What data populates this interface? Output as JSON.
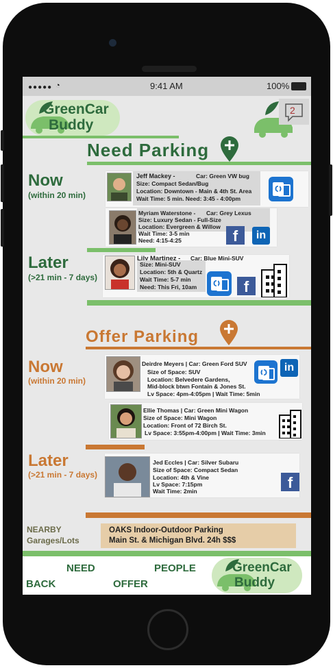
{
  "status": {
    "time": "9:41 AM",
    "battery": "100%"
  },
  "header": {
    "logo_line1": "GreenCar",
    "logo_line2": "Buddy",
    "notifications": "2"
  },
  "need": {
    "title": "Need Parking",
    "now_label": "Now",
    "now_sub": "(within 20 min)",
    "later_label": "Later",
    "later_sub": "(>21 min - 7 days)",
    "cards": [
      {
        "name": "Jeff Mackey -",
        "car": "Car: Green VW bug",
        "line2": "Size: Compact Sedan/Bug",
        "line3": "Location: Downtown - Main & 4th St. Area",
        "line4": "Wait Time: 5 min.       Need: 3:45 - 4:00pm"
      },
      {
        "name": "Myriam Waterstone -",
        "car": "Car: Grey Lexus",
        "line2": "Size:  Luxury Sedan - Full-Size",
        "line3": "Location:  Evergreen & Willow",
        "line4": "Wait Time:  3-5 min",
        "line5": "Need: 4:15-4:25"
      },
      {
        "name": "Lily Martinez -",
        "car": "Car:  Blue Mini-SUV",
        "line2": "Size:  Mini-SUV",
        "line3": "Location: 5th & Quartz",
        "line4": "Wait Time: 5-7 min",
        "line5": "Need: This Fri, 10am"
      }
    ]
  },
  "offer": {
    "title": "Offer Parking",
    "now_label": "Now",
    "now_sub": "(within 20 min)",
    "later_label": "Later",
    "later_sub": "(>21 min - 7 days)",
    "cards": [
      {
        "line1": "Deirdre Meyers  | Car: Green Ford SUV",
        "line2": "Size of Space: SUV",
        "line3": "Location: Belvedere Gardens,",
        "line4": "Mid-block btwn Fontain & Jones St.",
        "line5": "Lv Space:  4pm-4:05pm |   Wait Time: 5min"
      },
      {
        "line1": "Ellie Thomas | Car: Green Mini Wagon",
        "line2": "Size of Space:  Mini Wagon",
        "line3": "Location: Front of 72 Birch St.",
        "line4": "Lv Space:  3:55pm-4:00pm  | Wait Time: 3min"
      },
      {
        "line1": "Jed Eccles  | Car: Silver Subaru",
        "line2": "Size of Space: Compact Sedan",
        "line3": "Location:  4th & Vine",
        "line4": "Lv Space: 7:15pm",
        "line5": "Wait Time: 2min"
      }
    ]
  },
  "nearby": {
    "label1": "NEARBY",
    "label2": "Garages/Lots",
    "lot_line1": "OAKS Indoor-Outdoor Parking",
    "lot_line2": "Main St. & Michigan Blvd.  24h  $$$"
  },
  "tabs": {
    "need": "NEED",
    "people": "PEOPLE",
    "back": "BACK",
    "offer": "OFFER"
  },
  "colors": {
    "green": "#2e6b3d",
    "lightgreen": "#7bbf6a",
    "orange": "#c97833",
    "tan": "#e6cda8"
  }
}
